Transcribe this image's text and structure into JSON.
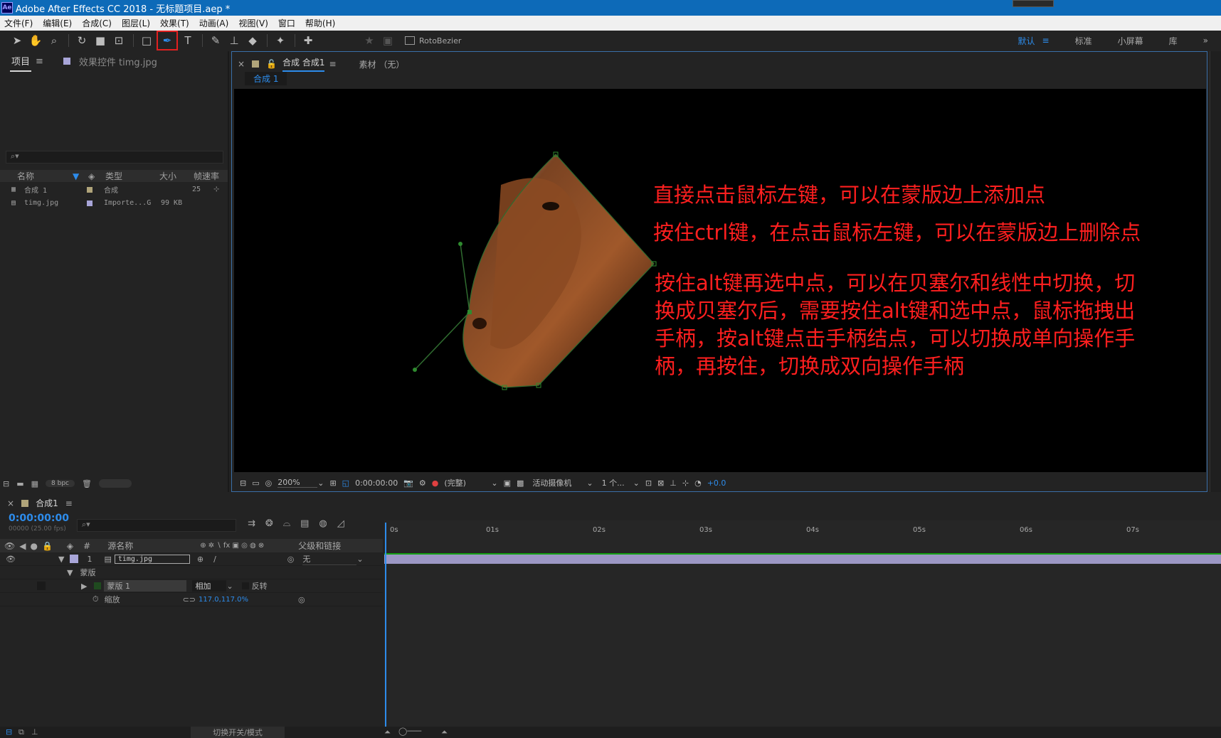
{
  "window": {
    "title": "Adobe After Effects CC 2018 - 无标题项目.aep *",
    "logo": "Ae"
  },
  "menu": [
    "文件(F)",
    "编辑(E)",
    "合成(C)",
    "图层(L)",
    "效果(T)",
    "动画(A)",
    "视图(V)",
    "窗口",
    "帮助(H)"
  ],
  "toolbar": {
    "rotobezier": "RotoBezier",
    "selected_tool": "pen-tool"
  },
  "workspaces": {
    "default": "默认",
    "standard": "标准",
    "small": "小屏幕",
    "library": "库"
  },
  "project": {
    "tab": "项目",
    "effects_tab": "效果控件 timg.jpg",
    "columns": {
      "name": "名称",
      "type": "类型",
      "size": "大小",
      "fps": "帧速率"
    },
    "items": [
      {
        "name": "合成 1",
        "type": "合成",
        "size": "",
        "fps": "25"
      },
      {
        "name": "timg.jpg",
        "type": "Importe...G",
        "size": "99 KB",
        "fps": ""
      }
    ],
    "bpc": "8 bpc"
  },
  "comp": {
    "tab": "合成 合成1",
    "footage_tab": "素材 （无）",
    "breadcrumb": "合成 1",
    "annotations": [
      "直接点击鼠标左键，可以在蒙版边上添加点",
      "按住ctrl键，在点击鼠标左键，可以在蒙版边上删除点",
      "按住alt键再选中点，可以在贝塞尔和线性中切换，切",
      "换成贝塞尔后，需要按住alt键和选中点，鼠标拖拽出",
      "手柄，按alt键点击手柄结点，可以切换成单向操作手",
      "柄，再按住，切换成双向操作手柄"
    ],
    "zoom": "200%",
    "timecode": "0:00:00:00",
    "resolution": "(完整)",
    "camera": "活动摄像机",
    "views": "1 个...",
    "exposure": "+0.0"
  },
  "timeline": {
    "tab": "合成1",
    "timecode": "0:00:00:00",
    "frame_info": "00000 (25.00 fps)",
    "col_source": "源名称",
    "col_parent": "父级和链接",
    "layer": {
      "index": "1",
      "name": "timg.jpg",
      "parent": "无"
    },
    "masks_group": "蒙版",
    "mask": {
      "name": "蒙版 1",
      "mode": "相加",
      "invert": "反转"
    },
    "scale": {
      "label": "缩放",
      "value": "117.0,117.0%"
    },
    "ruler": [
      "0s",
      "01s",
      "02s",
      "03s",
      "04s",
      "05s",
      "06s",
      "07s"
    ],
    "footer": "切换开关/模式"
  }
}
